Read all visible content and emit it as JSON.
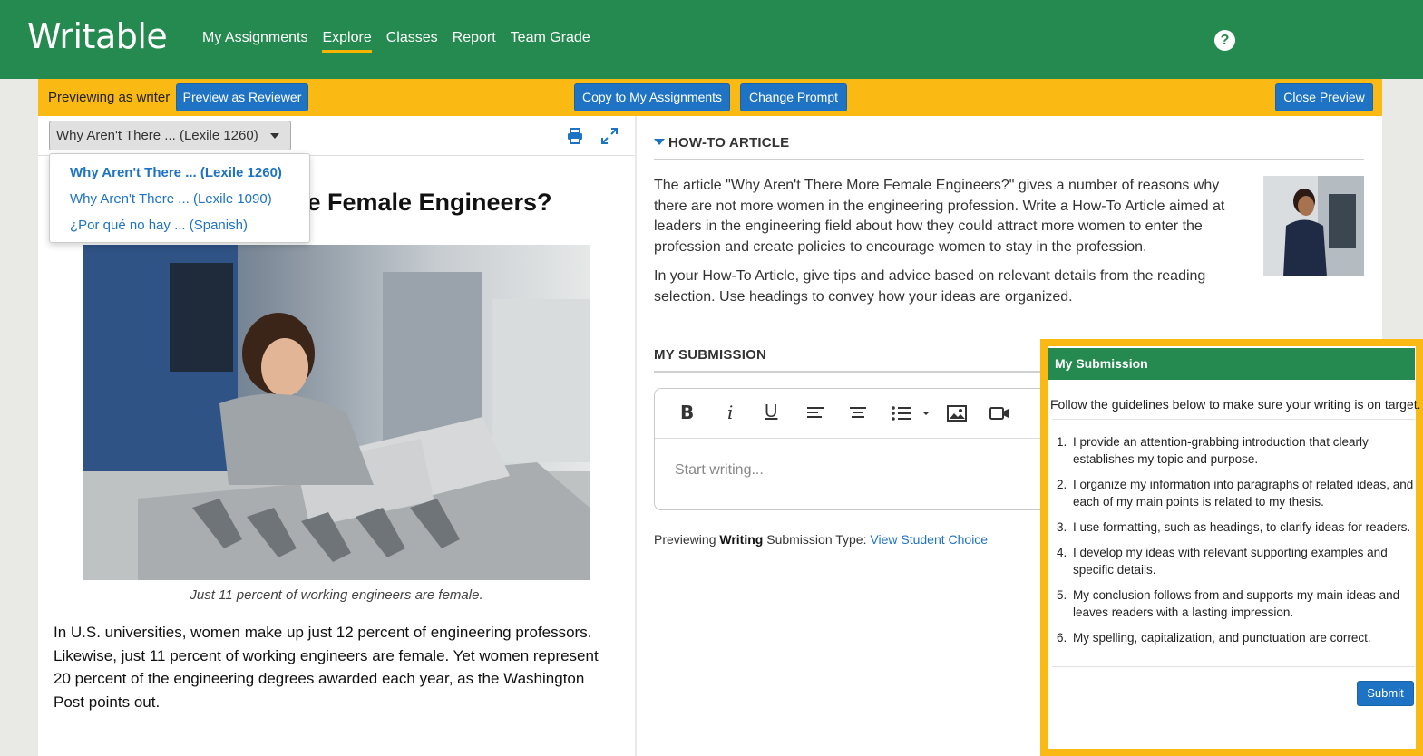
{
  "app": {
    "logo": "Writable"
  },
  "nav": {
    "items": [
      {
        "label": "My Assignments",
        "active": false
      },
      {
        "label": "Explore",
        "active": true
      },
      {
        "label": "Classes",
        "active": false
      },
      {
        "label": "Report",
        "active": false
      },
      {
        "label": "Team Grade",
        "active": false
      }
    ],
    "help_icon": "question-circle-icon"
  },
  "preview_bar": {
    "label": "Previewing as writer",
    "reviewer_button": "Preview as Reviewer",
    "copy_button": "Copy to My Assignments",
    "change_button": "Change Prompt",
    "close_button": "Close Preview"
  },
  "reading": {
    "selected_version": "Why Aren't There ... (Lexile 1260)",
    "versions": [
      "Why Aren't There ... (Lexile 1260)",
      "Why Aren't There ... (Lexile 1090)",
      "¿Por qué no hay ... (Spanish)"
    ],
    "title": "Why Aren't There More Female Engineers?",
    "caption": "Just 11 percent of working engineers are female.",
    "body": "In U.S. universities, women make up just 12 percent of engineering professors. Likewise, just 11 percent of working engineers are female. Yet women represent 20 percent of the engineering degrees awarded each year, as the Washington Post points out."
  },
  "prompt": {
    "heading": "HOW-TO ARTICLE",
    "paragraph1": "The article \"Why Aren't There More Female Engineers?\" gives a number of reasons why there are not more women in the engineering profession. Write a How-To Article aimed at leaders in the engineering field about how they could attract more women to enter the profession and create policies to encourage women to stay in the profession.",
    "paragraph2": "In your How-To Article, give tips and advice based on relevant details from the reading selection. Use headings to convey how your ideas are organized."
  },
  "submission": {
    "heading": "MY SUBMISSION",
    "placeholder": "Start writing...",
    "tools": [
      "bold-icon",
      "italic-icon",
      "underline-icon",
      "align-left-icon",
      "align-center-icon",
      "bullet-list-icon",
      "image-icon",
      "video-icon"
    ],
    "note_prefix": "Previewing",
    "note_type": "Writing",
    "note_suffix": "Submission Type:",
    "note_link": "View Student Choice"
  },
  "popup": {
    "title": "My Submission",
    "intro": "Follow the guidelines below to make sure your writing is on target.",
    "criteria": [
      "I provide an attention-grabbing introduction that clearly establishes my topic and purpose.",
      "I organize my information into paragraphs of related ideas, and each of my main points is related to my thesis.",
      "I use formatting, such as headings, to clarify ideas for readers.",
      "I develop my ideas with relevant supporting examples and specific details.",
      "My conclusion follows from and supports my main ideas and leaves readers with a lasting impression.",
      "My spelling, capitalization, and punctuation are correct."
    ],
    "submit_button": "Submit"
  },
  "colors": {
    "brand_green": "#258a4f",
    "accent_yellow": "#fbb914",
    "button_blue": "#1e73c4"
  }
}
